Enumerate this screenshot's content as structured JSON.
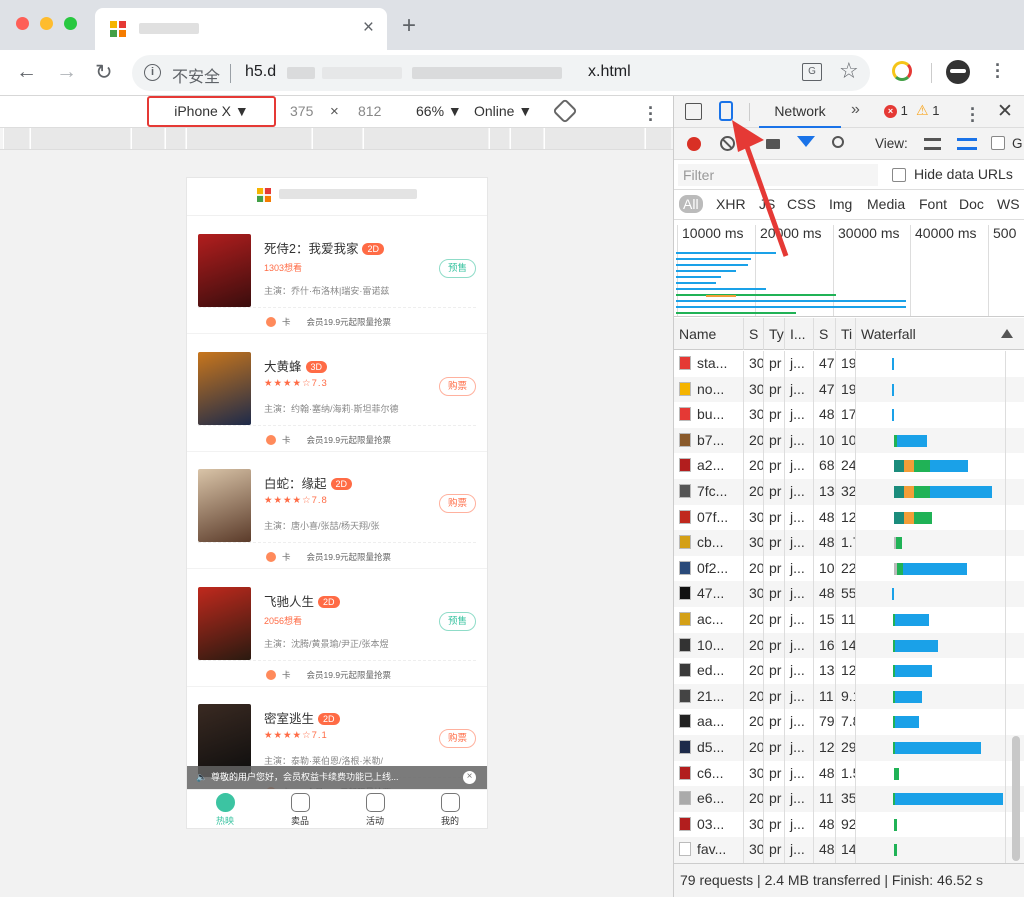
{
  "browser": {
    "tab_title": "",
    "address": {
      "insecure_label": "不安全",
      "url_host": "h5.d",
      "url_tail": "x.html"
    }
  },
  "emulation": {
    "device": "iPhone X ▼",
    "width": "375",
    "x": "×",
    "height": "812",
    "zoom": "66% ▼",
    "network": "Online ▼"
  },
  "phone": {
    "movies": [
      {
        "title": "死侍2：我爱我家",
        "fmt": "2D",
        "meta_type": "want",
        "meta": "1303想看",
        "cast": "主演：乔什·布洛林|瑞安·雷诺兹",
        "action": "预售",
        "action_type": "pre",
        "promo_k": "卡",
        "promo": "会员19.9元起限量抢票",
        "poster": [
          "#b21e1e",
          "#3a0d0d"
        ]
      },
      {
        "title": "大黄蜂",
        "fmt": "3D",
        "meta_type": "stars",
        "meta": "★★★★☆7.3",
        "cast": "主演：约翰·塞纳/海莉·斯坦菲尔德",
        "action": "购票",
        "action_type": "buy",
        "promo_k": "卡",
        "promo": "会员19.9元起限量抢票",
        "poster": [
          "#c8761c",
          "#1d2a4a"
        ]
      },
      {
        "title": "白蛇：缘起",
        "fmt": "2D",
        "meta_type": "stars",
        "meta": "★★★★☆7.8",
        "cast": "主演：唐小喜/张喆/杨天翔/张",
        "action": "购票",
        "action_type": "buy",
        "promo_k": "卡",
        "promo": "会员19.9元起限量抢票",
        "poster": [
          "#d9c4a8",
          "#5b3b2a"
        ]
      },
      {
        "title": "飞驰人生",
        "fmt": "2D",
        "meta_type": "want",
        "meta": "2056想看",
        "cast": "主演：沈腾/黄景瑜/尹正/张本煜",
        "action": "预售",
        "action_type": "pre",
        "promo_k": "卡",
        "promo": "会员19.9元起限量抢票",
        "poster": [
          "#c0291d",
          "#2a1a10"
        ]
      },
      {
        "title": "密室逃生",
        "fmt": "2D",
        "meta_type": "stars",
        "meta": "★★★★☆7.1",
        "cast": "主演：泰勒·莱伯恩/洛根·米勒/",
        "action": "购票",
        "action_type": "buy",
        "promo_k": "卡",
        "promo": "会员19.9元起限量抢票",
        "poster": [
          "#3a2a22",
          "#0d0d0d"
        ]
      }
    ],
    "notice": "尊敬的用户您好，会员权益卡续费功能已上线...",
    "notice_close": "×",
    "tabs": [
      {
        "label": "热映",
        "active": true
      },
      {
        "label": "卖品",
        "active": false
      },
      {
        "label": "活动",
        "active": false
      },
      {
        "label": "我的",
        "active": false
      }
    ]
  },
  "devtools": {
    "tab": "Network",
    "more": "»",
    "errors": "1",
    "err_icon": "×",
    "warnings": "1",
    "warn_icon": "⚠",
    "close": "✕",
    "view_label": "View:",
    "g_label": "G",
    "filter_placeholder": "Filter",
    "hide_data_urls": "Hide data URLs",
    "types": [
      "All",
      "XHR",
      "JS",
      "CSS",
      "Img",
      "Media",
      "Font",
      "Doc",
      "WS"
    ],
    "timeline_ticks": [
      "10000 ms",
      "20000 ms",
      "30000 ms",
      "40000 ms",
      "500"
    ],
    "columns": [
      "Name",
      "S",
      "Ty",
      "I...",
      "S",
      "Ti",
      "Waterfall"
    ],
    "rows": [
      {
        "name": "sta...",
        "s": "30",
        "t": "pr",
        "i": "j...",
        "sz": "47",
        "ti": "19"
      },
      {
        "name": "no...",
        "s": "30",
        "t": "pr",
        "i": "j...",
        "sz": "47",
        "ti": "19"
      },
      {
        "name": "bu...",
        "s": "30",
        "t": "pr",
        "i": "j...",
        "sz": "48",
        "ti": "17"
      },
      {
        "name": "b7...",
        "s": "20",
        "t": "pr",
        "i": "j...",
        "sz": "10",
        "ti": "10"
      },
      {
        "name": "a2...",
        "s": "20",
        "t": "pr",
        "i": "j...",
        "sz": "68",
        "ti": "24"
      },
      {
        "name": "7fc...",
        "s": "20",
        "t": "pr",
        "i": "j...",
        "sz": "13",
        "ti": "32"
      },
      {
        "name": "07f...",
        "s": "30",
        "t": "pr",
        "i": "j...",
        "sz": "48",
        "ti": "12"
      },
      {
        "name": "cb...",
        "s": "30",
        "t": "pr",
        "i": "j...",
        "sz": "48",
        "ti": "1.7"
      },
      {
        "name": "0f2...",
        "s": "20",
        "t": "pr",
        "i": "j...",
        "sz": "10",
        "ti": "22"
      },
      {
        "name": "47...",
        "s": "30",
        "t": "pr",
        "i": "j...",
        "sz": "48",
        "ti": "55"
      },
      {
        "name": "ac...",
        "s": "20",
        "t": "pr",
        "i": "j...",
        "sz": "15",
        "ti": "11"
      },
      {
        "name": "10...",
        "s": "20",
        "t": "pr",
        "i": "j...",
        "sz": "16",
        "ti": "14"
      },
      {
        "name": "ed...",
        "s": "20",
        "t": "pr",
        "i": "j...",
        "sz": "13",
        "ti": "12"
      },
      {
        "name": "21...",
        "s": "20",
        "t": "pr",
        "i": "j...",
        "sz": "11",
        "ti": "9.1"
      },
      {
        "name": "aa...",
        "s": "20",
        "t": "pr",
        "i": "j...",
        "sz": "79",
        "ti": "7.8"
      },
      {
        "name": "d5...",
        "s": "20",
        "t": "pr",
        "i": "j...",
        "sz": "12",
        "ti": "29"
      },
      {
        "name": "c6...",
        "s": "30",
        "t": "pr",
        "i": "j...",
        "sz": "48",
        "ti": "1.5"
      },
      {
        "name": "e6...",
        "s": "20",
        "t": "pr",
        "i": "j...",
        "sz": "11",
        "ti": "35"
      },
      {
        "name": "03...",
        "s": "30",
        "t": "pr",
        "i": "j...",
        "sz": "48",
        "ti": "92"
      },
      {
        "name": "fav...",
        "s": "30",
        "t": "pr",
        "i": "j...",
        "sz": "48",
        "ti": "14"
      }
    ],
    "status": "79 requests | 2.4 MB transferred | Finish: 46.52 s"
  },
  "colors": {
    "accent": "#1a73e8",
    "waterfall_blue": "#1aa1e8",
    "waterfall_green": "#20b256",
    "waterfall_orange": "#f29e38",
    "waterfall_teal": "#1b8c7c",
    "annotation_red": "#e53935"
  }
}
